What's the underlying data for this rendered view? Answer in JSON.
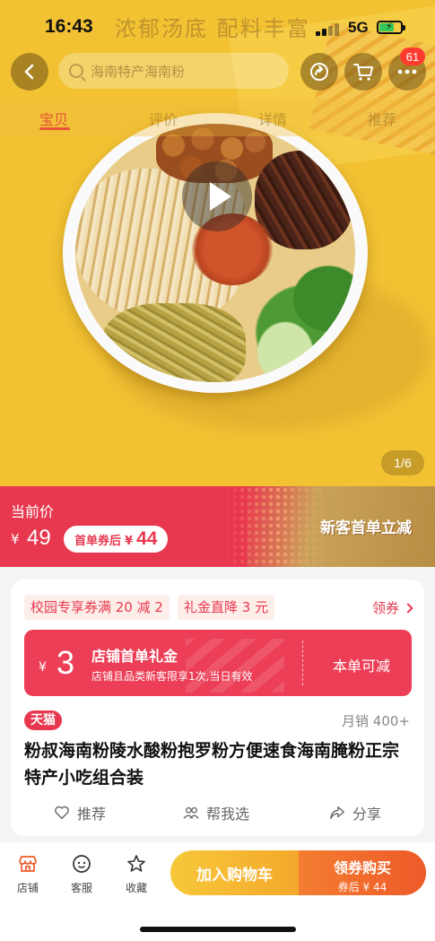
{
  "status_bar": {
    "time": "16:43",
    "network": "5G",
    "overlay_slogan": "浓郁汤底  配料丰富"
  },
  "nav": {
    "search_placeholder": "海南特产海南粉",
    "more_badge": "61",
    "icons": [
      "back-icon",
      "share-icon",
      "cart-icon",
      "more-icon"
    ]
  },
  "tabs": [
    {
      "label": "宝贝",
      "active": true
    },
    {
      "label": "评价",
      "active": false
    },
    {
      "label": "详情",
      "active": false
    },
    {
      "label": "推荐",
      "active": false
    }
  ],
  "gallery": {
    "pager": "1/6"
  },
  "price": {
    "label": "当前价",
    "currency": "¥",
    "amount": "49",
    "after_coupon_label": "首单券后",
    "after_coupon_currency": "¥",
    "after_coupon_amount": "44",
    "promo": "新客首单立减"
  },
  "coupons": {
    "chips": [
      "校园专享券满 20 减 2",
      "礼金直降 3 元"
    ],
    "get_link": "领券",
    "gift": {
      "currency": "¥",
      "amount": "3",
      "title": "店铺首单礼金",
      "desc": "店铺且品类新客限享1次,当日有效",
      "action": "本单可减"
    }
  },
  "product": {
    "tag": "天猫",
    "sales": "月销 400+",
    "title": "粉叔海南粉陵水酸粉抱罗粉方便速食海南腌粉正宗特产小吃组合装"
  },
  "actions": [
    {
      "label": "推荐",
      "icon": "heart-icon"
    },
    {
      "label": "帮我选",
      "icon": "people-icon"
    },
    {
      "label": "分享",
      "icon": "share-arrow-icon"
    }
  ],
  "bottom_bar": {
    "items": [
      {
        "label": "店铺",
        "icon": "store-icon"
      },
      {
        "label": "客服",
        "icon": "service-icon"
      },
      {
        "label": "收藏",
        "icon": "star-icon"
      }
    ],
    "add_to_cart": "加入购物车",
    "buy_label": "领券购买",
    "buy_sub": "券后 ¥ 44"
  },
  "colors": {
    "brand_red": "#e8384f",
    "orange": "#ee5a2a",
    "yellow": "#f7c83a"
  }
}
